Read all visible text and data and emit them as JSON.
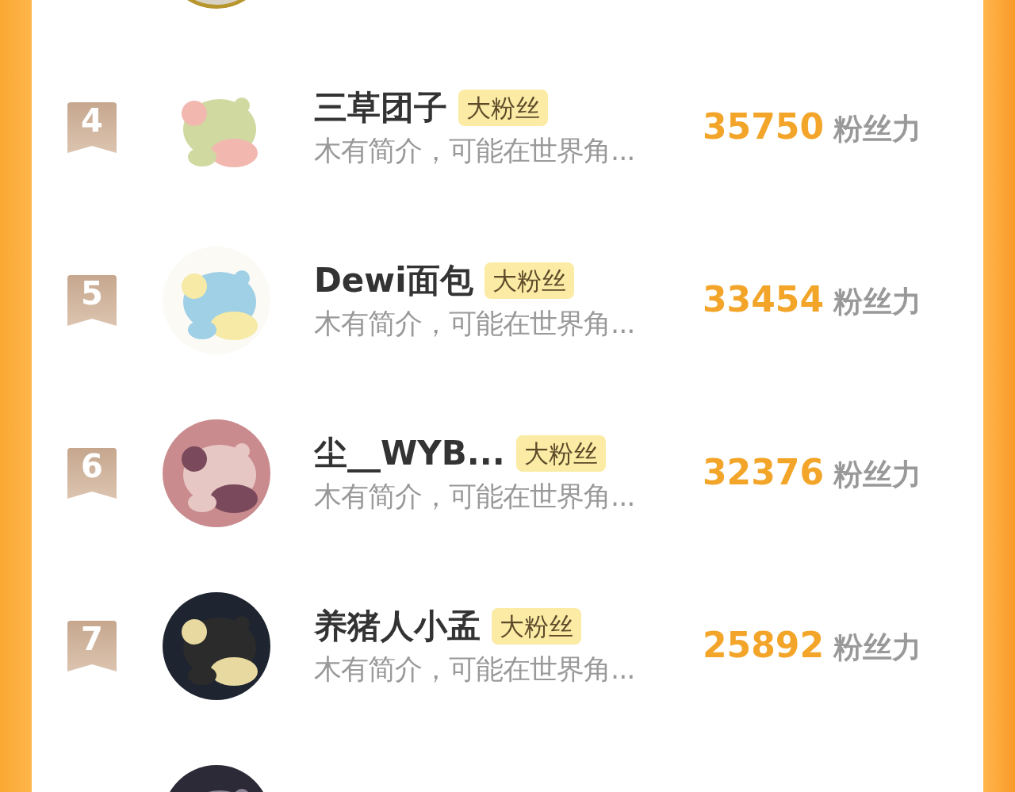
{
  "rows": [
    {
      "avatar": {
        "kind": "picture",
        "ring": true
      }
    },
    {
      "rank": "4",
      "avatar": {
        "kind": "picture"
      },
      "name": "三草团子",
      "badge": "大粉丝",
      "bio": "木有简介，可能在世界角...",
      "score": "35750",
      "unit": "粉丝力"
    },
    {
      "rank": "5",
      "avatar": {
        "kind": "picture"
      },
      "name": "Dewi面包",
      "badge": "大粉丝",
      "bio": "木有简介，可能在世界角...",
      "score": "33454",
      "unit": "粉丝力"
    },
    {
      "rank": "6",
      "avatar": {
        "kind": "picture"
      },
      "name": "尘__WYB...",
      "badge": "大粉丝",
      "bio": "木有简介，可能在世界角...",
      "score": "32376",
      "unit": "粉丝力"
    },
    {
      "rank": "7",
      "avatar": {
        "kind": "picture"
      },
      "name": "养猪人小孟",
      "badge": "大粉丝",
      "bio": "木有简介，可能在世界角...",
      "score": "25892",
      "unit": "粉丝力"
    },
    {
      "avatar": {
        "kind": "picture"
      }
    }
  ]
}
